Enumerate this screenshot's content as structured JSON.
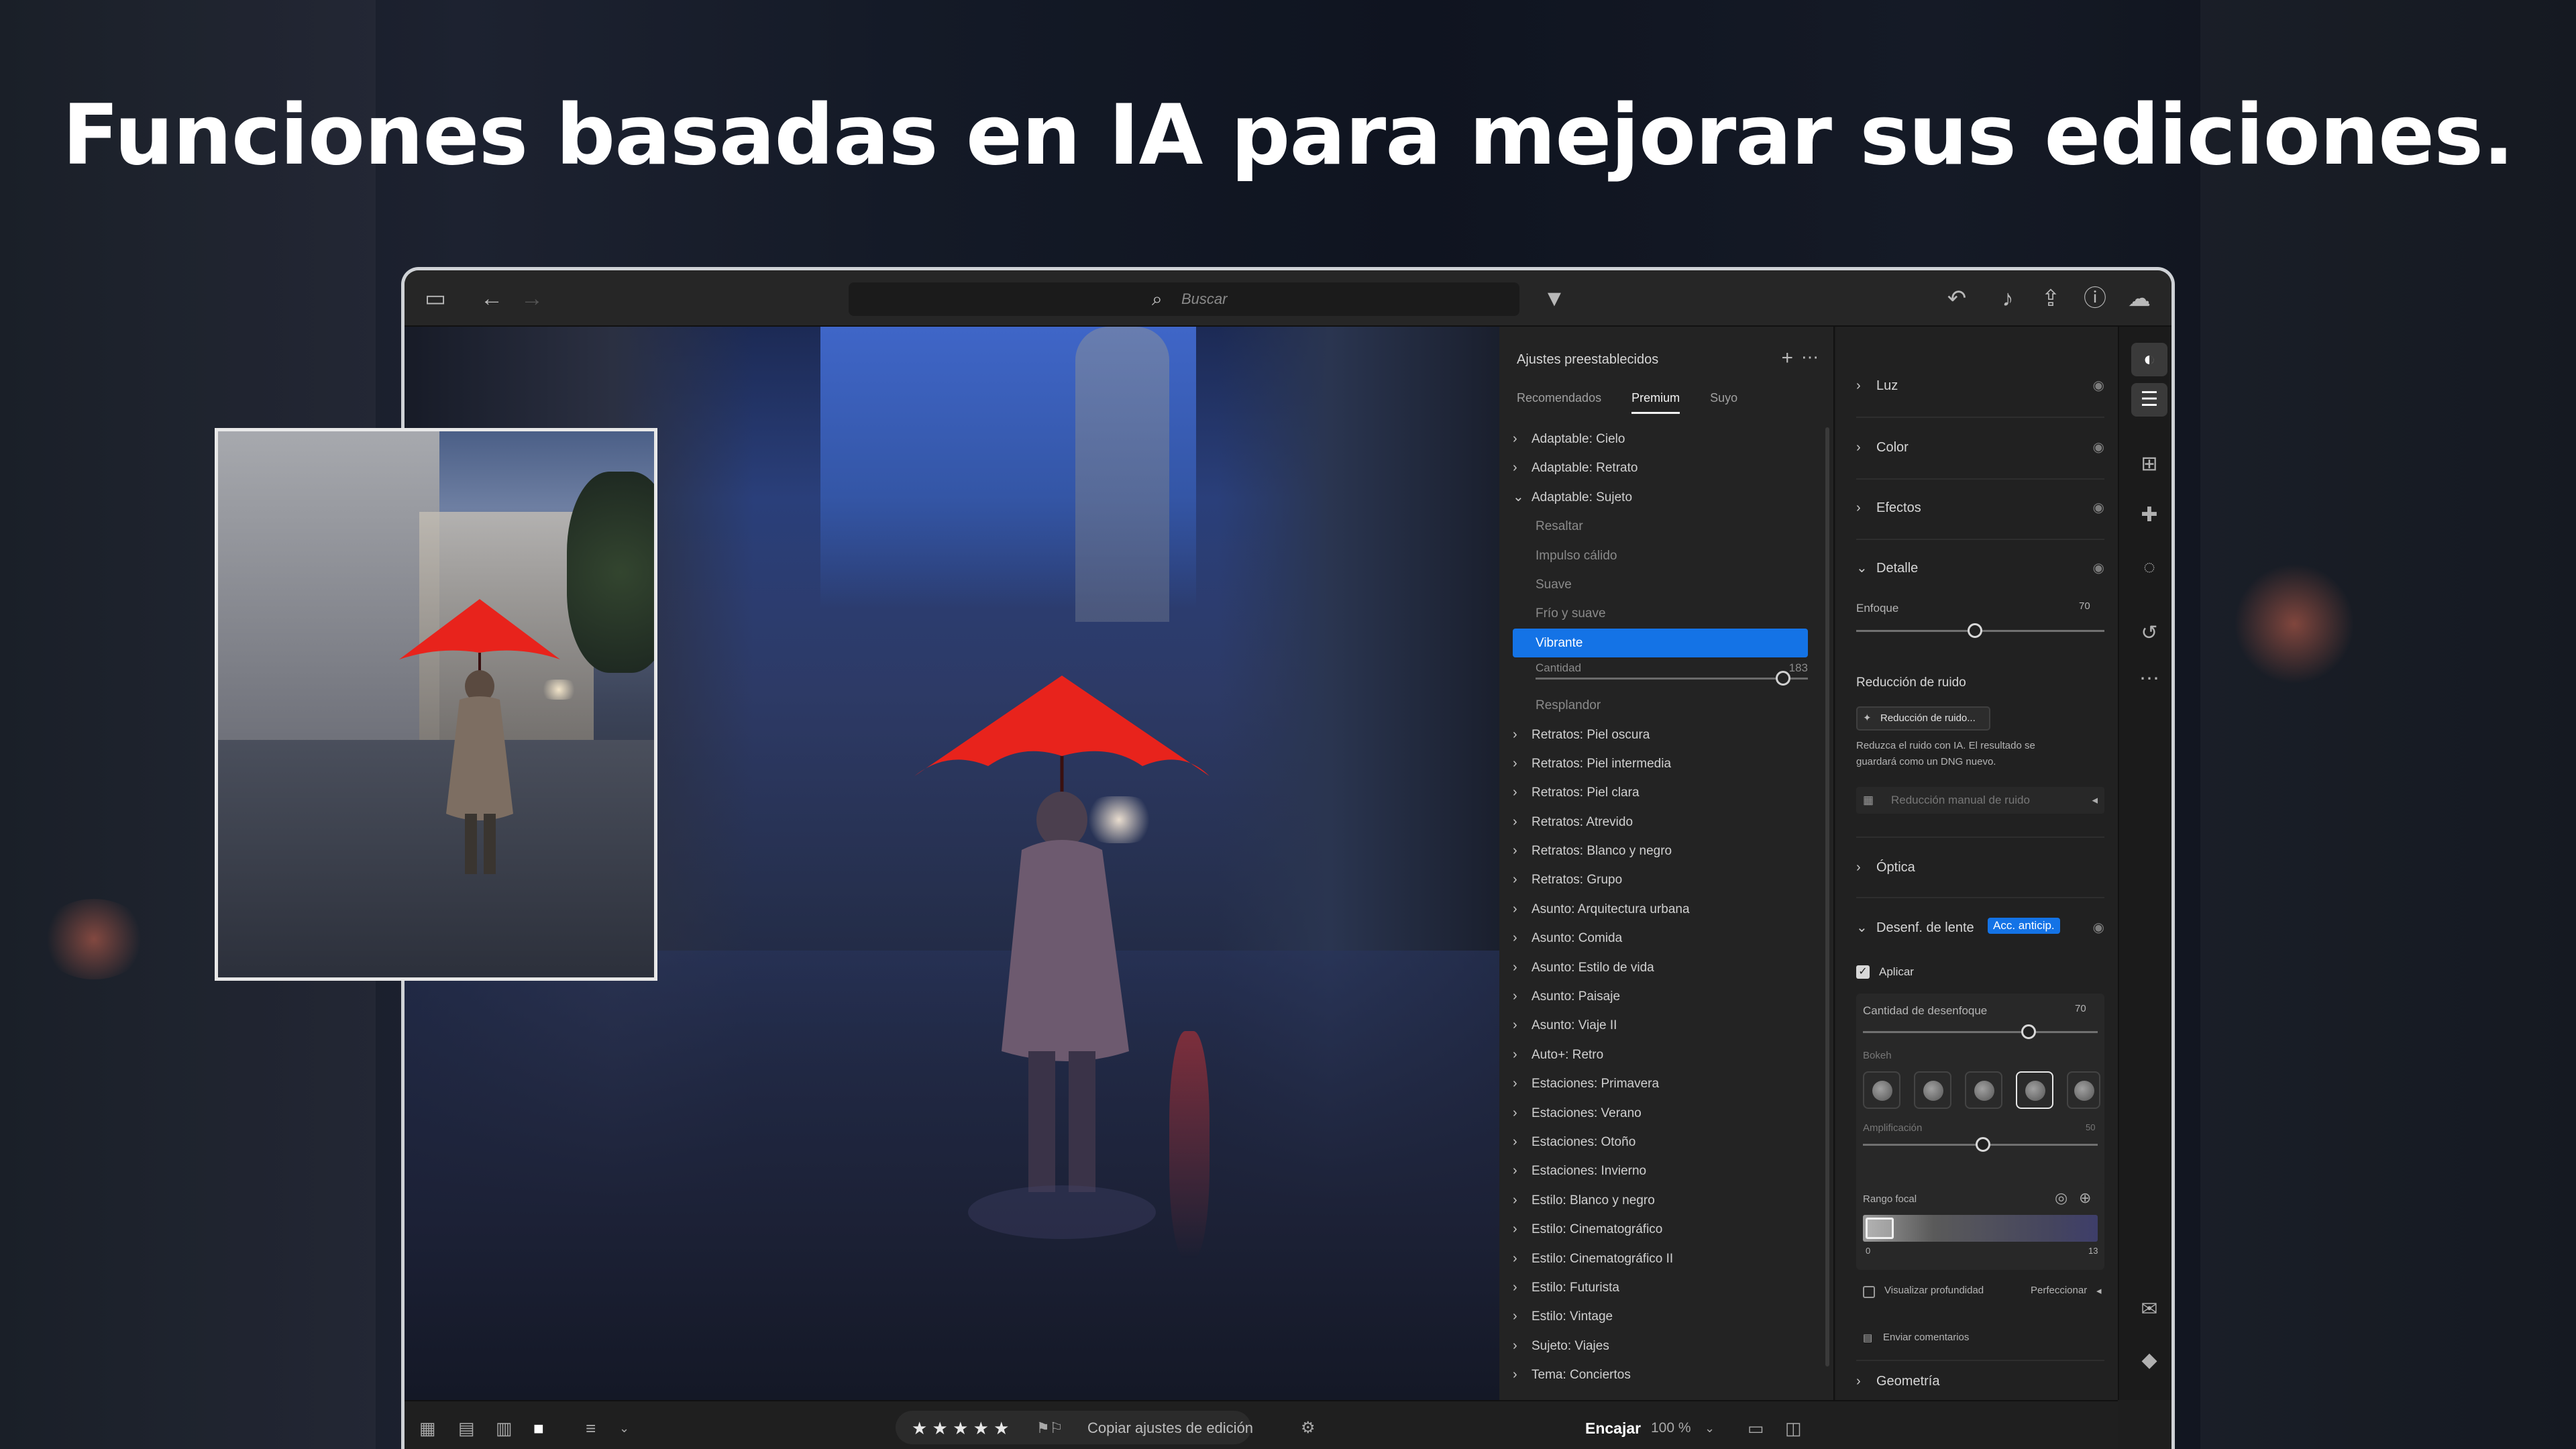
{
  "headline": "Funciones basadas en IA para mejorar sus ediciones.",
  "toolbar": {
    "search_placeholder": "Buscar",
    "icons": [
      "panel-toggle-icon",
      "back-arrow-icon",
      "forward-arrow-icon",
      "filter-icon",
      "undo-icon",
      "bell-icon",
      "share-icon",
      "help-icon",
      "cloud-icon"
    ]
  },
  "presets": {
    "title": "Ajustes preestablecidos",
    "tabs": [
      "Recomendados",
      "Premium",
      "Suyo"
    ],
    "active_tab": "Premium",
    "items": [
      {
        "label": "Adaptable: Cielo",
        "kind": "group"
      },
      {
        "label": "Adaptable: Retrato",
        "kind": "group"
      },
      {
        "label": "Adaptable: Sujeto",
        "kind": "open"
      },
      {
        "label": "Resaltar",
        "kind": "sub"
      },
      {
        "label": "Impulso cálido",
        "kind": "sub"
      },
      {
        "label": "Suave",
        "kind": "sub"
      },
      {
        "label": "Frío y suave",
        "kind": "sub"
      },
      {
        "label": "Vibrante",
        "kind": "selected"
      },
      {
        "label": "Cantidad",
        "kind": "slider",
        "value": "183"
      },
      {
        "label": "Resplandor",
        "kind": "sub"
      },
      {
        "label": "Retratos: Piel oscura",
        "kind": "group"
      },
      {
        "label": "Retratos: Piel intermedia",
        "kind": "group"
      },
      {
        "label": "Retratos: Piel clara",
        "kind": "group"
      },
      {
        "label": "Retratos: Atrevido",
        "kind": "group"
      },
      {
        "label": "Retratos: Blanco y negro",
        "kind": "group"
      },
      {
        "label": "Retratos: Grupo",
        "kind": "group"
      },
      {
        "label": "Asunto: Arquitectura urbana",
        "kind": "group"
      },
      {
        "label": "Asunto: Comida",
        "kind": "group"
      },
      {
        "label": "Asunto: Estilo de vida",
        "kind": "group"
      },
      {
        "label": "Asunto: Paisaje",
        "kind": "group"
      },
      {
        "label": "Asunto: Viaje II",
        "kind": "group"
      },
      {
        "label": "Auto+: Retro",
        "kind": "group"
      },
      {
        "label": "Estaciones: Primavera",
        "kind": "group"
      },
      {
        "label": "Estaciones: Verano",
        "kind": "group"
      },
      {
        "label": "Estaciones: Otoño",
        "kind": "group"
      },
      {
        "label": "Estaciones: Invierno",
        "kind": "group"
      },
      {
        "label": "Estilo: Blanco y negro",
        "kind": "group"
      },
      {
        "label": "Estilo: Cinematográfico",
        "kind": "group"
      },
      {
        "label": "Estilo: Cinematográfico II",
        "kind": "group"
      },
      {
        "label": "Estilo: Futurista",
        "kind": "group"
      },
      {
        "label": "Estilo: Vintage",
        "kind": "group"
      },
      {
        "label": "Sujeto: Viajes",
        "kind": "group"
      },
      {
        "label": "Tema: Conciertos",
        "kind": "group"
      }
    ]
  },
  "edit": {
    "sections": {
      "luz": "Luz",
      "color": "Color",
      "efectos": "Efectos",
      "detalle": "Detalle",
      "optica": "Óptica",
      "desenf": "Desenf. de lente",
      "geometria": "Geometría"
    },
    "enfoque_label": "Enfoque",
    "enfoque_value": "70",
    "ruido_title": "Reducción de ruido",
    "ruido_button": "Reducción de ruido...",
    "ruido_desc_1": "Reduzca el ruido con IA. El resultado se",
    "ruido_desc_2": "guardará como un DNG nuevo.",
    "ruido_manual": "Reducción manual de ruido",
    "acc_badge": "Acc. anticip.",
    "aplicar": "Aplicar",
    "cantidad_label": "Cantidad de desenfoque",
    "cantidad_value": "70",
    "bokeh_label": "Bokeh",
    "ampl_label": "Amplificación",
    "ampl_value": "50",
    "rango_label": "Rango focal",
    "rango_min": "0",
    "rango_max": "13",
    "visualizar": "Visualizar profundidad",
    "perfeccionar": "Perfeccionar",
    "comentarios": "Enviar comentarios"
  },
  "bottombar": {
    "stars": "★ ★ ★ ★ ★",
    "copy": "Copiar ajustes de edición",
    "fit": "Encajar",
    "zoom": "100 %"
  },
  "colors": {
    "accent": "#1473e6",
    "umbrella": "#e8231c"
  }
}
